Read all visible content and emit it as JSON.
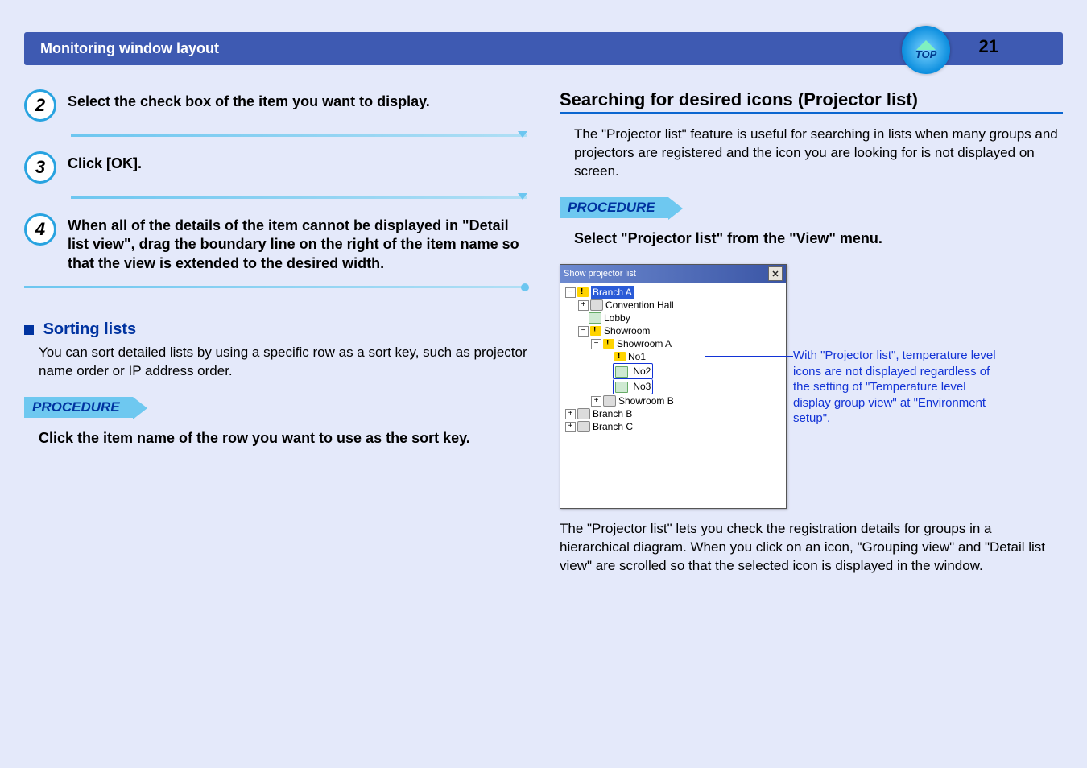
{
  "header": {
    "title": "Monitoring window layout",
    "page_number": "21",
    "top_label": "TOP"
  },
  "left": {
    "step2": {
      "num": "2",
      "text": "Select the check box of the item you want to display."
    },
    "step3": {
      "num": "3",
      "text": "Click [OK]."
    },
    "step4": {
      "num": "4",
      "text": "When all of the details of the item cannot be displayed in \"Detail list view\", drag the boundary line on the right of the item name so that the view is extended to the desired width."
    },
    "sorting_heading": "Sorting lists",
    "sorting_body": "You can sort detailed lists by using a specific row as a sort key, such as projector name order or IP address order.",
    "procedure_label": "PROCEDURE",
    "sorting_instruction": "Click the item name of the row you want to use as the sort key."
  },
  "right": {
    "heading": "Searching for desired icons (Projector list)",
    "intro": "The \"Projector list\" feature is useful for searching in lists when many groups and projectors are registered and the icon you are looking for is not displayed on screen.",
    "procedure_label": "PROCEDURE",
    "instruction": "Select \"Projector list\" from the \"View\" menu.",
    "window_title": "Show projector list",
    "tree": {
      "branch_a": "Branch A",
      "conv_hall": "Convention Hall",
      "lobby": "Lobby",
      "showroom": "Showroom",
      "showroom_a": "Showroom A",
      "no1": "No1",
      "no2": "No2",
      "no3": "No3",
      "showroom_b": "Showroom B",
      "branch_b": "Branch B",
      "branch_c": "Branch C"
    },
    "note": "With \"Projector list\", temperature level icons are not displayed regardless of the setting of \"Temperature level display group view\" at \"Environment setup\".",
    "after_text": "The \"Projector list\" lets you check the registration details for groups in a hierarchical diagram. When you click on an icon, \"Grouping view\" and \"Detail list view\" are scrolled so that the selected icon is displayed in the window."
  }
}
